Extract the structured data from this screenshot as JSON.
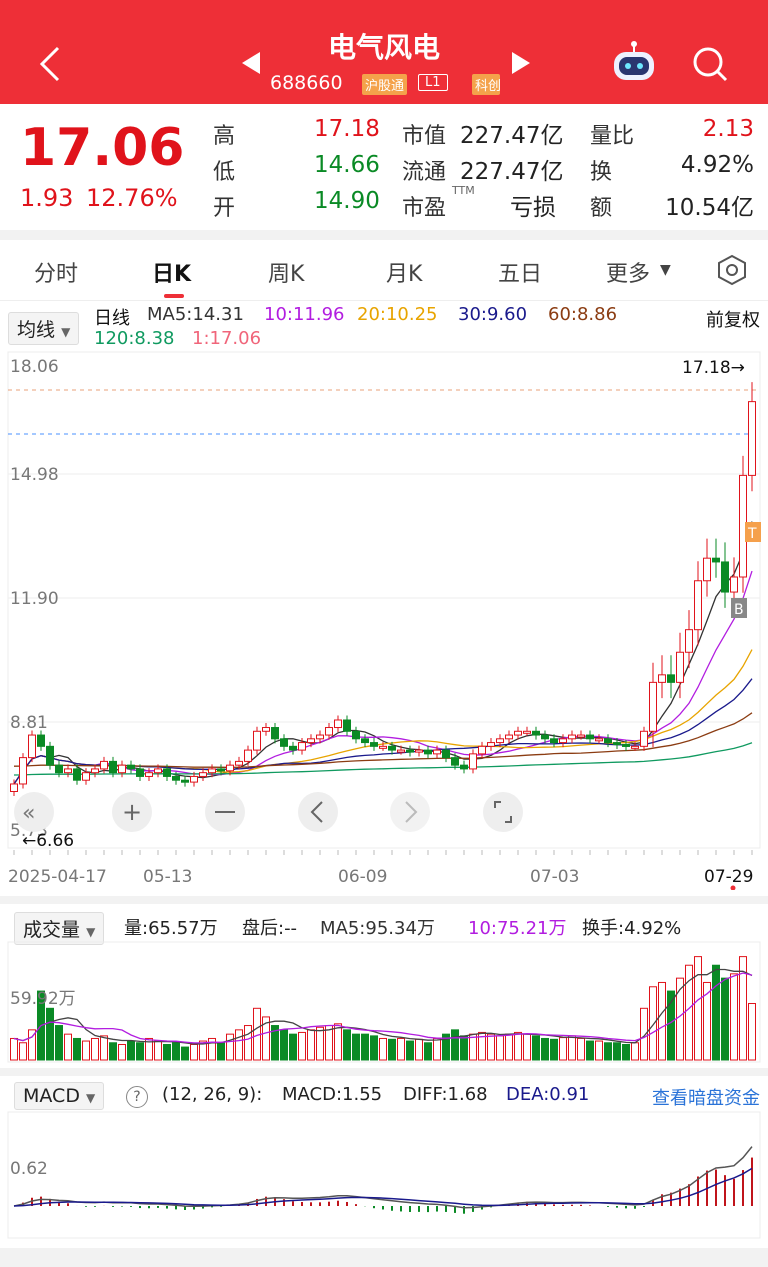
{
  "header": {
    "title": "电气风电",
    "code": "688660",
    "tag_hgt": "沪股通",
    "tag_l1": "L1",
    "tag_kc": "科创"
  },
  "quote": {
    "price": "17.06",
    "change": "1.93",
    "change_pct": "12.76%",
    "rows": [
      {
        "l1": "高",
        "v1": "17.18",
        "l2": "市值",
        "v2": "227.47亿",
        "l3": "量比",
        "v3": "2.13"
      },
      {
        "l1": "低",
        "v1": "14.66",
        "l2": "流通",
        "v2": "227.47亿",
        "l3": "换",
        "v3": "4.92%"
      },
      {
        "l1": "开",
        "v1": "14.90",
        "l2": "市盈",
        "sup": "TTM",
        "v2": "亏损",
        "l3": "额",
        "v3": "10.54亿"
      }
    ]
  },
  "tabs": [
    "分时",
    "日K",
    "周K",
    "月K",
    "五日",
    "更多"
  ],
  "ma": {
    "dropdown": "均线",
    "label": "日线",
    "ma5": "MA5:14.31",
    "ma10": "10:11.96",
    "ma20": "20:10.25",
    "ma30": "30:9.60",
    "ma60": "60:8.86",
    "ma120": "120:8.38",
    "ma1": "1:17.06",
    "adjust": "前复权"
  },
  "kline": {
    "y_labels": [
      "18.06",
      "14.98",
      "11.90",
      "8.81",
      "5.73"
    ],
    "high_label": "17.18→",
    "low_label": "←6.66",
    "dates": [
      "2025-04-17",
      "05-13",
      "06-09",
      "07-03",
      "07-29"
    ],
    "marker_t": "T",
    "marker_b": "B"
  },
  "volume": {
    "dropdown": "成交量",
    "vol": "量:65.57万",
    "after": "盘后:--",
    "ma5": "MA5:95.34万",
    "ma10": "10:75.21万",
    "turnover": "换手:4.92%",
    "y_label": "59.92万"
  },
  "macd": {
    "dropdown": "MACD",
    "help": "?",
    "params": "(12, 26, 9):",
    "macd": "MACD:1.55",
    "diff": "DIFF:1.68",
    "dea": "DEA:0.91",
    "link": "查看暗盘资金",
    "y_label": "0.62"
  },
  "chart_data": {
    "type": "candlestick",
    "y_range": [
      5.73,
      18.06
    ],
    "close": [
      6.9,
      7.6,
      8.2,
      7.9,
      7.4,
      7.2,
      7.3,
      7.0,
      7.2,
      7.3,
      7.5,
      7.2,
      7.4,
      7.3,
      7.1,
      7.2,
      7.3,
      7.1,
      7.0,
      6.95,
      7.1,
      7.2,
      7.3,
      7.25,
      7.4,
      7.5,
      7.8,
      8.3,
      8.4,
      8.1,
      7.9,
      7.8,
      8.0,
      8.1,
      8.2,
      8.4,
      8.6,
      8.3,
      8.1,
      8.0,
      7.9,
      7.9,
      7.8,
      7.8,
      7.75,
      7.8,
      7.7,
      7.8,
      7.6,
      7.4,
      7.3,
      7.7,
      7.9,
      8.0,
      8.1,
      8.2,
      8.3,
      8.3,
      8.2,
      8.1,
      8.0,
      8.1,
      8.2,
      8.2,
      8.1,
      8.1,
      8.0,
      7.95,
      7.9,
      7.9,
      8.3,
      9.6,
      9.8,
      9.6,
      10.4,
      11.0,
      12.3,
      12.9,
      12.8,
      12.0,
      12.4,
      15.1,
      17.06
    ],
    "volume_wan": [
      25,
      20,
      35,
      80,
      60,
      40,
      30,
      25,
      22,
      25,
      28,
      20,
      18,
      22,
      20,
      25,
      22,
      18,
      20,
      15,
      18,
      22,
      25,
      20,
      30,
      35,
      40,
      60,
      50,
      40,
      35,
      30,
      32,
      35,
      38,
      40,
      42,
      35,
      30,
      30,
      28,
      25,
      24,
      25,
      22,
      24,
      20,
      25,
      30,
      35,
      28,
      30,
      32,
      30,
      28,
      30,
      32,
      30,
      28,
      25,
      24,
      26,
      28,
      25,
      22,
      22,
      20,
      20,
      18,
      20,
      60,
      85,
      90,
      80,
      95,
      110,
      120,
      90,
      110,
      95,
      100,
      120,
      65.57
    ]
  }
}
